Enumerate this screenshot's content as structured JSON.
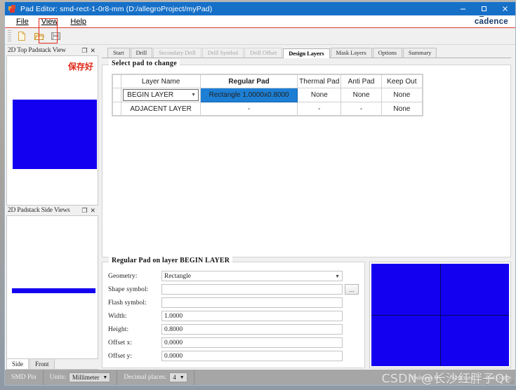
{
  "window": {
    "title": "Pad Editor: smd-rect-1-0r8-mm  (D:/allegroProject/myPad)",
    "minimize": "—",
    "maximize": "□",
    "close": "✕"
  },
  "menubar": {
    "items": [
      "File",
      "View",
      "Help"
    ],
    "brand": "cadence"
  },
  "toolbar": {
    "new_label": "new-file",
    "open_label": "open-file",
    "save_label": "save-file"
  },
  "left_dock": {
    "top_panel": {
      "title": "2D Top Padstack View",
      "float_btn": "❐",
      "close_btn": "✕",
      "annotation": "保存好"
    },
    "side_panel": {
      "title": "2D Padstack Side Views",
      "float_btn": "❐",
      "close_btn": "✕"
    },
    "view_tabs": [
      {
        "label": "Side",
        "selected": true
      },
      {
        "label": "Front",
        "selected": false
      }
    ]
  },
  "tabs": [
    {
      "label": "Start",
      "state": "normal"
    },
    {
      "label": "Drill",
      "state": "normal"
    },
    {
      "label": "Secondary Drill",
      "state": "disabled"
    },
    {
      "label": "Drill Symbol",
      "state": "disabled"
    },
    {
      "label": "Drill Offset",
      "state": "disabled"
    },
    {
      "label": "Design Layers",
      "state": "active"
    },
    {
      "label": "Mask Layers",
      "state": "normal"
    },
    {
      "label": "Options",
      "state": "normal"
    },
    {
      "label": "Summary",
      "state": "normal"
    }
  ],
  "select_pad_group": {
    "title": "Select pad to change",
    "columns": [
      "Layer Name",
      "Regular Pad",
      "Thermal Pad",
      "Anti Pad",
      "Keep Out"
    ],
    "rows": [
      {
        "layer_name": "BEGIN LAYER",
        "layer_is_combo": true,
        "regular_pad": "Rectangle 1.0000x0.8000",
        "regular_selected": true,
        "thermal_pad": "None",
        "anti_pad": "None",
        "keep_out": "None",
        "dim": false
      },
      {
        "layer_name": "ADJACENT LAYER",
        "layer_is_combo": false,
        "regular_pad": "-",
        "regular_selected": false,
        "thermal_pad": "-",
        "anti_pad": "-",
        "keep_out": "None",
        "dim": true
      }
    ]
  },
  "regular_pad_group": {
    "title": "Regular Pad on layer BEGIN LAYER",
    "fields": [
      {
        "label": "Geometry:",
        "value": "Rectangle",
        "type": "select"
      },
      {
        "label": "Shape symbol:",
        "value": "",
        "type": "text-browse",
        "browse_label": "..."
      },
      {
        "label": "Flash symbol:",
        "value": "",
        "type": "text"
      },
      {
        "label": "Width:",
        "value": "1.0000",
        "type": "text"
      },
      {
        "label": "Height:",
        "value": "0.8000",
        "type": "text"
      },
      {
        "label": "Offset x:",
        "value": "0.0000",
        "type": "text"
      },
      {
        "label": "Offset y:",
        "value": "0.0000",
        "type": "text"
      }
    ]
  },
  "statusbar": {
    "pin_type": "SMD Pin",
    "units_label": "Units:",
    "units_value": "Millimeter",
    "decimal_label": "Decimal places:",
    "decimal_value": "4",
    "caret": "▼",
    "info_left": "Padstack D",
    "info_mid": "Structure",
    "info_right": "Pad Usage",
    "watermark": "CSDN @长沙红胖子Qt"
  },
  "colors": {
    "pad_blue": "#1400f0",
    "selection_blue": "#1d7fd4",
    "title_blue": "#1670c8",
    "accent_red": "#e02718",
    "brand_navy": "#17396b"
  }
}
